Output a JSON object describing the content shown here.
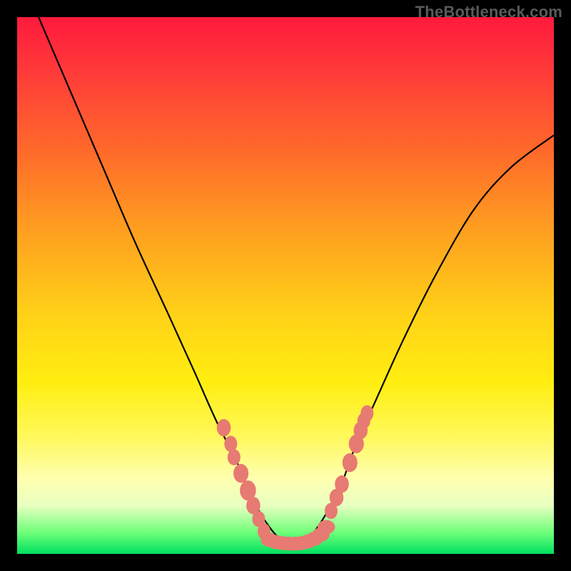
{
  "watermark": "TheBottleneck.com",
  "chart_data": {
    "type": "line",
    "title": "",
    "xlabel": "",
    "ylabel": "",
    "xlim": [
      0,
      100
    ],
    "ylim": [
      0,
      100
    ],
    "series": [
      {
        "name": "curve",
        "x": [
          4,
          10,
          16,
          22,
          28,
          33,
          37,
          41,
          44,
          47,
          50,
          53,
          56,
          60,
          63,
          67,
          72,
          78,
          85,
          92,
          100
        ],
        "y": [
          100,
          86,
          72,
          58,
          45,
          34,
          25,
          17,
          10,
          5,
          2,
          2,
          5,
          12,
          20,
          29,
          40,
          52,
          64,
          72,
          78
        ]
      }
    ],
    "left_cluster": [
      {
        "x": 38.5,
        "y": 23.5,
        "r": 1.3
      },
      {
        "x": 39.8,
        "y": 20.5,
        "r": 1.2
      },
      {
        "x": 40.4,
        "y": 18.0,
        "r": 1.2
      },
      {
        "x": 41.7,
        "y": 15.0,
        "r": 1.4
      },
      {
        "x": 43.0,
        "y": 11.8,
        "r": 1.5
      },
      {
        "x": 44.0,
        "y": 9.0,
        "r": 1.3
      },
      {
        "x": 45.0,
        "y": 6.5,
        "r": 1.2
      },
      {
        "x": 46.0,
        "y": 4.2,
        "r": 1.2
      }
    ],
    "right_cluster": [
      {
        "x": 58.5,
        "y": 8.0,
        "r": 1.2
      },
      {
        "x": 59.5,
        "y": 10.5,
        "r": 1.3
      },
      {
        "x": 60.5,
        "y": 13.0,
        "r": 1.3
      },
      {
        "x": 62.0,
        "y": 17.0,
        "r": 1.4
      },
      {
        "x": 63.2,
        "y": 20.5,
        "r": 1.4
      },
      {
        "x": 64.0,
        "y": 23.0,
        "r": 1.3
      },
      {
        "x": 64.6,
        "y": 24.8,
        "r": 1.2
      },
      {
        "x": 65.2,
        "y": 26.2,
        "r": 1.2
      }
    ],
    "bottom_cluster": [
      {
        "x": 47.0,
        "y": 2.6,
        "r": 1.3
      },
      {
        "x": 48.2,
        "y": 2.2,
        "r": 1.3
      },
      {
        "x": 49.4,
        "y": 2.0,
        "r": 1.3
      },
      {
        "x": 50.6,
        "y": 1.9,
        "r": 1.3
      },
      {
        "x": 51.8,
        "y": 1.9,
        "r": 1.3
      },
      {
        "x": 53.0,
        "y": 2.0,
        "r": 1.3
      },
      {
        "x": 54.2,
        "y": 2.3,
        "r": 1.3
      },
      {
        "x": 55.4,
        "y": 2.8,
        "r": 1.3
      },
      {
        "x": 56.6,
        "y": 3.6,
        "r": 1.3
      },
      {
        "x": 57.6,
        "y": 5.0,
        "r": 1.3
      }
    ]
  }
}
